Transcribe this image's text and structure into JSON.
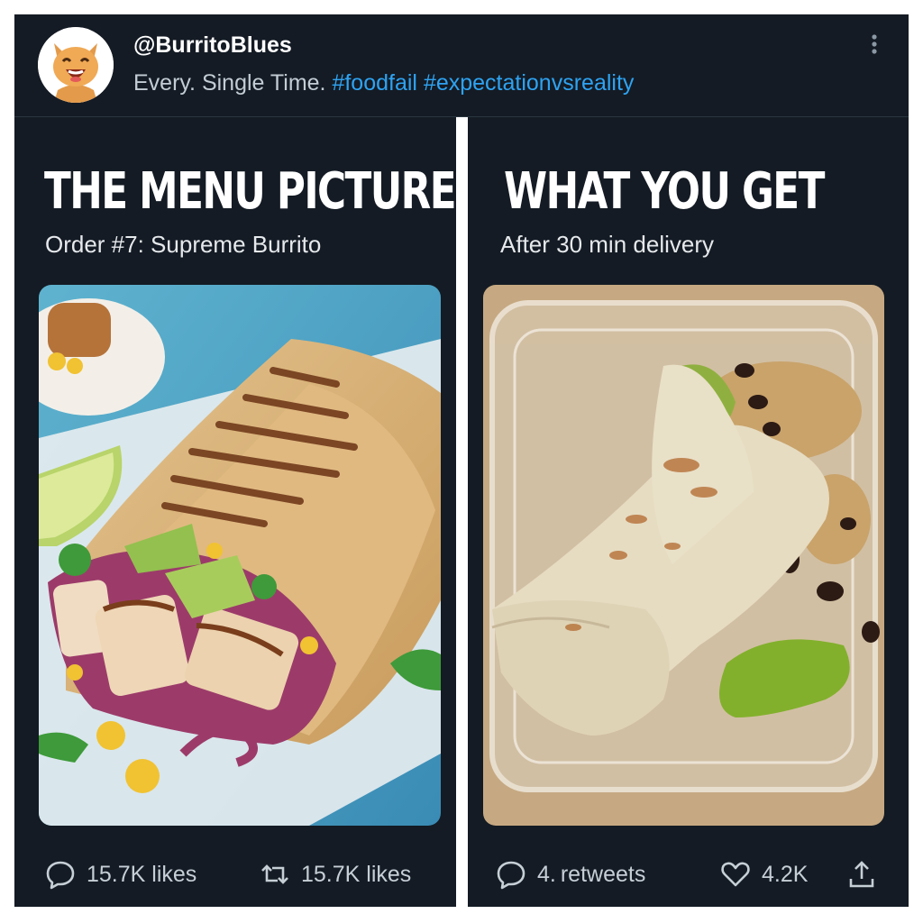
{
  "post": {
    "handle": "@BurritoBlues",
    "caption_text": "Every. Single Time. ",
    "hashtags": [
      "#foodfail",
      "#expectationvsreality"
    ]
  },
  "panels": {
    "left": {
      "title": "THE MENU PICTURE",
      "subtitle": "Order #7: Supreme Burrito",
      "image": "grilled-burrito-menu-photo"
    },
    "right": {
      "title": "WHAT YOU GET",
      "subtitle": "After 30 min delivery",
      "image": "squashed-burrito-in-container-photo"
    }
  },
  "actions": {
    "left": [
      {
        "icon": "reply-icon",
        "label": "15.7K likes"
      },
      {
        "icon": "retweet-icon",
        "label": "15.7K likes"
      }
    ],
    "right": [
      {
        "icon": "reply-icon",
        "label": "4. retweets"
      },
      {
        "icon": "heart-icon",
        "label": "4.2K"
      },
      {
        "icon": "share-icon",
        "label": ""
      }
    ]
  },
  "colors": {
    "background": "#141b24",
    "hashtag": "#2ea3f2",
    "divider": "#ffffff"
  }
}
